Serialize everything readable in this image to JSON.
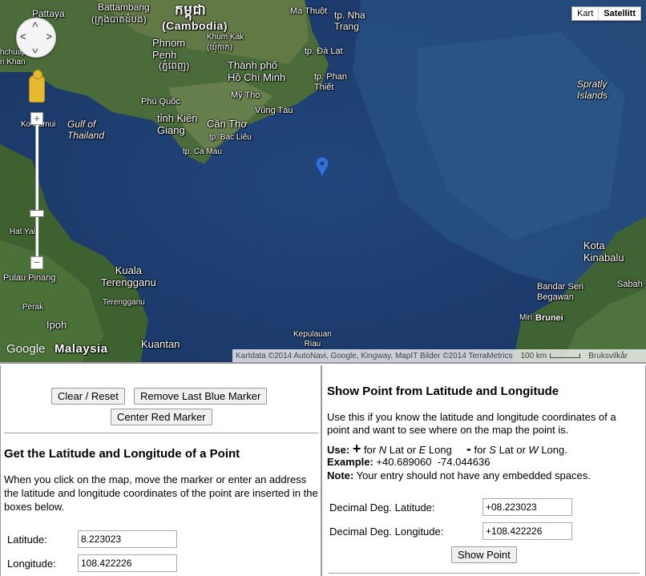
{
  "map": {
    "type_controls": {
      "map_label": "Kart",
      "satellite_label": "Satellitt"
    },
    "labels": {
      "pattaya": "Pattaya",
      "battambang": "Battambang",
      "battambang_native": "(ក្រុងបាត់ដំបង)",
      "cambodia_native": "កម្ពុជា",
      "cambodia": "(Cambodia)",
      "ma_thuot": "Ma Thuột",
      "nha_trang": "tp. Nha\nTrang",
      "phnom_penh": "Phnom\nPenh",
      "phnom_penh_native": "(ភ្នំពេញ)",
      "khum_kak": "Khum Kak\n(ឃុំកាក់)",
      "da_lat": "tp. Đà Lạt",
      "ho_chi_minh": "Thành phố\nHồ Chí Minh",
      "phan_thiet": "tp. Phan\nThiết",
      "my_tho": "Mỹ Tho",
      "vung_tau": "Vũng Tàu",
      "phu_quoc": "Phú Quốc",
      "kien_giang": "tỉnh Kiên\nGiang",
      "can_tho": "Cần Thơ",
      "bac_lieu": "tp. Bạc Liêu",
      "ca_mau": "tp. Cà Mau",
      "gulf_thailand": "Gulf of\nThailand",
      "spratly": "Spratly\nIslands",
      "kota_kinabalu": "Kota\nKinabalu",
      "sabah": "Sabah",
      "bandar_seri": "Bandar Seri\nBegawan",
      "brunei": "Brunei",
      "miri": "Miri",
      "kuala_terengganu": "Kuala\nTerengganu",
      "terengganu": "Terengganu",
      "kuantan": "Kuantan",
      "malaysia": "Malaysia",
      "pulau_pinang": "Pulau Pinang",
      "perak": "Perak",
      "ipoh": "Ipoh",
      "kepulauan_riau": "Kepulauan\nRiau",
      "ko_samui": "Ko Samui",
      "hat_yai": "Hat Yai",
      "chumphon": "hchuap\nri Khan"
    },
    "google_logo": "Google",
    "attribution": "Kartdata ©2014 AutoNavi, Google, Kingway, MapIT Bilder ©2014 TerraMetrics",
    "scale_label": "100 km",
    "terms_label": "Bruksvilkår"
  },
  "left_panel": {
    "clear_reset": "Clear / Reset",
    "remove_last_blue": "Remove Last Blue Marker",
    "center_red": "Center Red Marker",
    "title": "Get the Latitude and Longitude of a Point",
    "description": "When you click on the map, move the marker or enter an address the latitude and longitude coordinates of the point are inserted in the boxes below.",
    "latitude_label": "Latitude:",
    "latitude_value": "8.223023",
    "longitude_label": "Longitude:",
    "longitude_value": "108.422226"
  },
  "right_panel": {
    "title": "Show Point from Latitude and Longitude",
    "description": "Use this if you know the latitude and longitude coordinates of a point and want to see where on the map the point is.",
    "use_label": "Use:",
    "plus_sign": "+",
    "plus_text_1": " for ",
    "n": "N",
    "lat_or": " Lat or ",
    "e": "E",
    "long_1": " Long",
    "minus_sign": "-",
    "minus_text_1": " for ",
    "s": "S",
    "lat_or_2": " Lat or ",
    "w": "W",
    "long_2": " Long.",
    "example_label": "Example:",
    "example_value": " +40.689060  -74.044636",
    "note_label": "Note:",
    "note_text": " Your entry should not have any embedded spaces.",
    "dec_lat_label": "Decimal Deg. Latitude:",
    "dec_lat_value": "+08.223023",
    "dec_long_label": "Decimal Deg. Longitude:",
    "dec_long_value": "+108.422226",
    "show_point": "Show Point"
  }
}
